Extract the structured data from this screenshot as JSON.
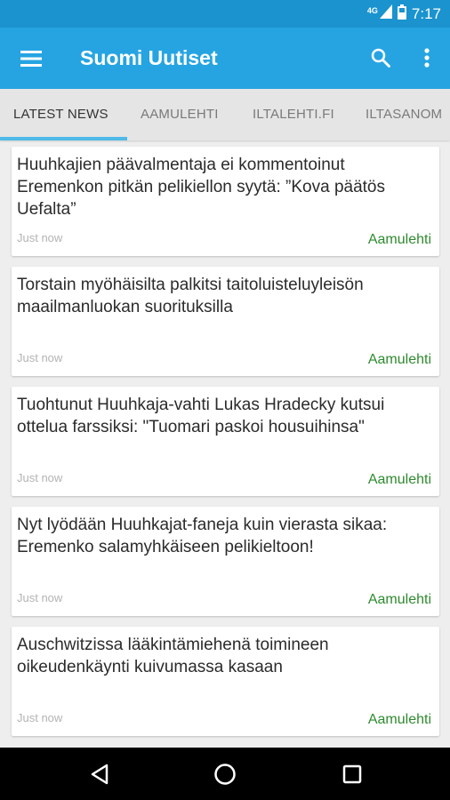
{
  "status_bar": {
    "network": "4G",
    "time": "7:17",
    "icons": [
      "signal-icon",
      "battery-icon"
    ]
  },
  "app_bar": {
    "title": "Suomi Uutiset",
    "icons": [
      "menu-icon",
      "search-icon",
      "more-vert-icon"
    ]
  },
  "tabs": [
    {
      "label": "LATEST NEWS",
      "active": true
    },
    {
      "label": "AAMULEHTI",
      "active": false
    },
    {
      "label": "ILTALEHTI.FI",
      "active": false
    },
    {
      "label": "ILTASANOM",
      "active": false
    }
  ],
  "articles": [
    {
      "title": "Huuhkajien päävalmentaja ei kommentoinut Eremenkon pitkän pelikiellon syytä: ”Kova päätös Uefalta”",
      "time": "Just now",
      "source": "Aamulehti"
    },
    {
      "title": "Torstain myöhäisilta palkitsi taitoluisteluyleisön maailmanluokan suorituksilla",
      "time": "Just now",
      "source": "Aamulehti"
    },
    {
      "title": "Tuohtunut Huuhkaja-vahti Lukas Hradecky kutsui ottelua farssiksi: \"Tuomari paskoi housuihinsa\"",
      "time": "Just now",
      "source": "Aamulehti"
    },
    {
      "title": "Nyt lyödään Huuhkajat-faneja kuin vierasta sikaa: Eremenko salamyhkäiseen pelikieltoon!",
      "time": "Just now",
      "source": "Aamulehti"
    },
    {
      "title": "Auschwitzissa lääkintämiehenä toimineen oikeudenkäynti kuivumassa kasaan",
      "time": "Just now",
      "source": "Aamulehti"
    }
  ],
  "nav_bar": {
    "icons": [
      "back-icon",
      "home-icon",
      "recents-icon"
    ]
  },
  "colors": {
    "status_bar": "#1a93cf",
    "app_bar": "#26a4e2",
    "tab_indicator": "#4fb9e8",
    "source_text": "#2e8b2e"
  }
}
